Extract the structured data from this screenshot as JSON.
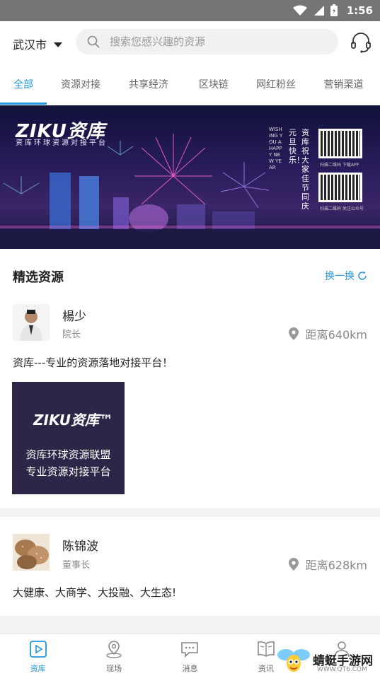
{
  "status_bar": {
    "time": "1:56"
  },
  "header": {
    "city": "武汉市",
    "search_placeholder": "搜索您感兴趣的资源"
  },
  "tabs": [
    {
      "label": "全部",
      "active": true
    },
    {
      "label": "资源对接",
      "active": false
    },
    {
      "label": "共享经济",
      "active": false
    },
    {
      "label": "区块链",
      "active": false
    },
    {
      "label": "网红粉丝",
      "active": false
    },
    {
      "label": "营销渠道",
      "active": false
    }
  ],
  "banner": {
    "brand": "ZIKU资库",
    "brand_sub": "资库环球资源对接平台",
    "greeting_1": "资库祝大家佳节同庆",
    "greeting_2": "元旦快乐！",
    "greeting_en": "WISHING YOU A HAPPY NEW YEAR",
    "qr_caption_1": "扫描二维码 下载APP",
    "qr_caption_2": "扫描二维码 关注公众号"
  },
  "section": {
    "title": "精选资源",
    "refresh_label": "换一换"
  },
  "cards": [
    {
      "name": "楊少",
      "title": "院长",
      "distance": "距离640km",
      "description": "资库---专业的资源落地对接平台！",
      "promo": {
        "logo": "ZIKU资库™",
        "line1": "资库环球资源联盟",
        "line2": "专业资源对接平台"
      }
    },
    {
      "name": "陈锦波",
      "title": "董事长",
      "distance": "距离628km",
      "description": "大健康、大商学、大投融、大生态!"
    }
  ],
  "bottom_nav": [
    {
      "label": "资库",
      "icon": "ziku-icon",
      "active": true
    },
    {
      "label": "现场",
      "icon": "location-pin-icon",
      "active": false
    },
    {
      "label": "消息",
      "icon": "message-icon",
      "active": false
    },
    {
      "label": "资讯",
      "icon": "book-icon",
      "active": false
    },
    {
      "label": "",
      "icon": "person-icon",
      "active": false
    }
  ],
  "watermark": {
    "text": "蜻蜓手游网",
    "url": "WWW.QT6.COM"
  },
  "colors": {
    "accent": "#2196d9",
    "status_bar": "#757575",
    "divider": "#f2f2f2"
  }
}
